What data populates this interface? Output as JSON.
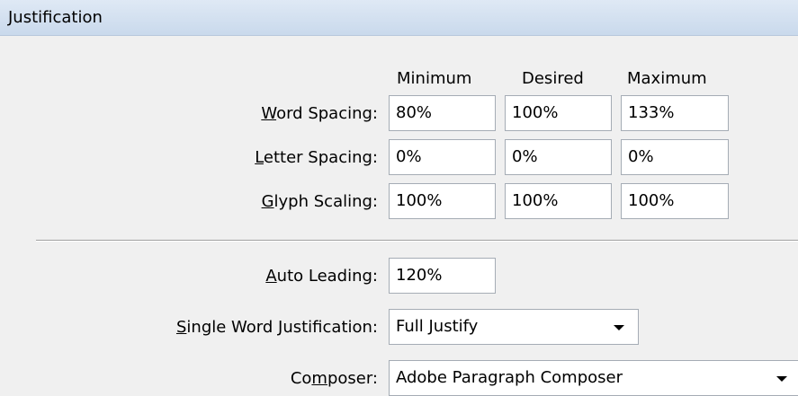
{
  "panel": {
    "title": "Justification"
  },
  "columns": {
    "minimum": "Minimum",
    "desired": "Desired",
    "maximum": "Maximum"
  },
  "word_spacing": {
    "mnemonic": "W",
    "label_rest": "ord Spacing:",
    "minimum": "80%",
    "desired": "100%",
    "maximum": "133%"
  },
  "letter_spacing": {
    "mnemonic": "L",
    "label_rest": "etter Spacing:",
    "minimum": "0%",
    "desired": "0%",
    "maximum": "0%"
  },
  "glyph_scaling": {
    "mnemonic": "G",
    "label_rest": "lyph Scaling:",
    "minimum": "100%",
    "desired": "100%",
    "maximum": "100%"
  },
  "auto_leading": {
    "mnemonic": "A",
    "label_rest": "uto Leading:",
    "value": "120%"
  },
  "single_word": {
    "mnemonic": "S",
    "label_rest": "ingle Word Justification:",
    "value": "Full Justify"
  },
  "composer": {
    "label_before": "Co",
    "mnemonic": "m",
    "label_after": "poser:",
    "value": "Adobe Paragraph Composer"
  }
}
